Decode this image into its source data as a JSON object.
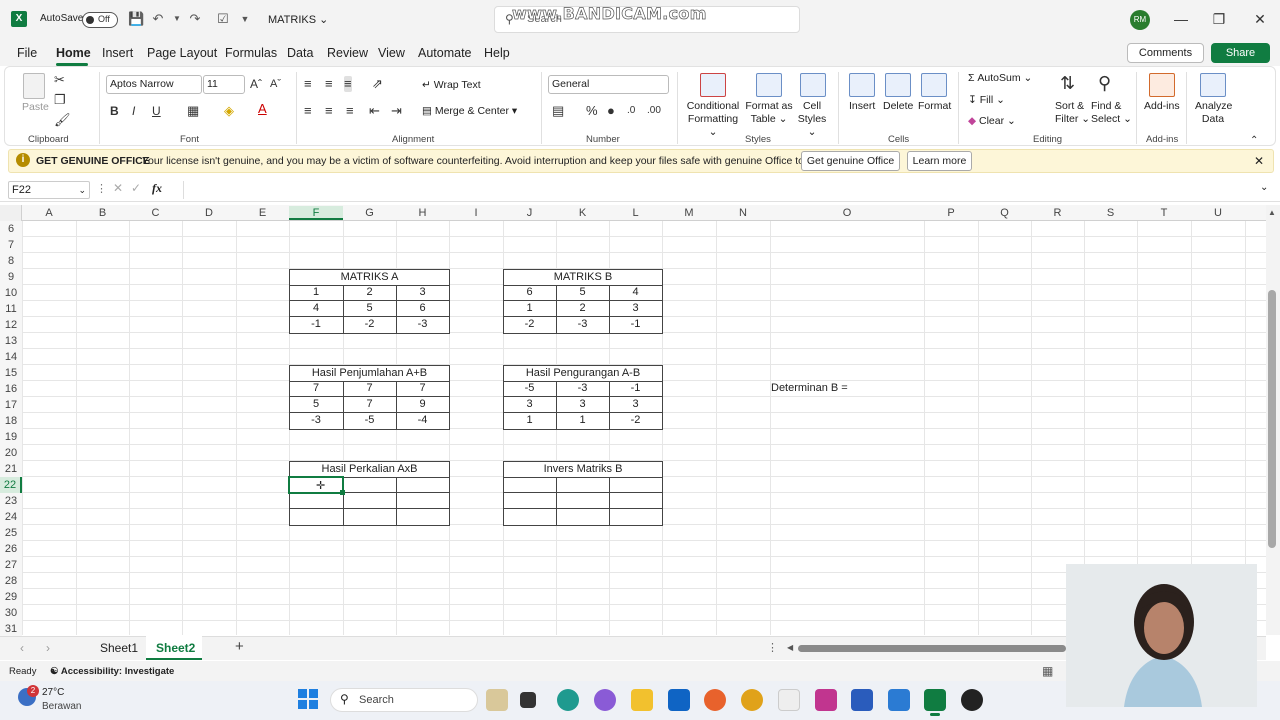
{
  "window": {
    "title": "MATRIKS",
    "autosave_label": "AutoSave",
    "autosave_state": "Off",
    "search_placeholder": "Search",
    "watermark": "www.BANDICAM.com",
    "user_initials": "RM",
    "accent": "#107c41"
  },
  "menu": {
    "items": [
      "File",
      "Home",
      "Insert",
      "Page Layout",
      "Formulas",
      "Data",
      "Review",
      "View",
      "Automate",
      "Help"
    ],
    "comments": "Comments",
    "share": "Share"
  },
  "ribbon": {
    "paste": "Paste",
    "clipboard": "Clipboard",
    "font_name": "Aptos Narrow",
    "font_size": "11",
    "font": "Font",
    "wrap_text": "Wrap Text",
    "merge_center": "Merge & Center",
    "alignment": "Alignment",
    "number_format": "General",
    "number": "Number",
    "cond_format_1": "Conditional",
    "cond_format_2": "Formatting",
    "format_table_1": "Format as",
    "format_table_2": "Table",
    "cell_styles_1": "Cell",
    "cell_styles_2": "Styles",
    "styles": "Styles",
    "insert": "Insert",
    "delete": "Delete",
    "format": "Format",
    "cells": "Cells",
    "autosum": "AutoSum",
    "fill": "Fill",
    "clear": "Clear",
    "sort_filter_1": "Sort &",
    "sort_filter_2": "Filter",
    "find_select_1": "Find &",
    "find_select_2": "Select",
    "editing": "Editing",
    "addins": "Add-ins",
    "addins_group": "Add-ins",
    "analyze_1": "Analyze",
    "analyze_2": "Data"
  },
  "infobar": {
    "title": "GET GENUINE OFFICE",
    "message": "Your license isn't genuine, and you may be a victim of software counterfeiting. Avoid interruption and keep your files safe with genuine Office today.",
    "get_button": "Get genuine Office",
    "learn_button": "Learn more"
  },
  "formula_bar": {
    "name_box": "F22",
    "fx": "fx"
  },
  "columns": [
    "A",
    "B",
    "C",
    "D",
    "E",
    "F",
    "G",
    "H",
    "I",
    "J",
    "K",
    "L",
    "M",
    "N",
    "O",
    "P",
    "Q",
    "R",
    "S",
    "T",
    "U"
  ],
  "rows": [
    "6",
    "7",
    "8",
    "9",
    "10",
    "11",
    "12",
    "13",
    "14",
    "15",
    "16",
    "17",
    "18",
    "19",
    "20",
    "21",
    "22",
    "23",
    "24",
    "25",
    "26",
    "27",
    "28",
    "29",
    "30",
    "31"
  ],
  "tables": {
    "matriks_a": {
      "title": "MATRIKS A",
      "cells": [
        [
          "1",
          "2",
          "3"
        ],
        [
          "4",
          "5",
          "6"
        ],
        [
          "-1",
          "-2",
          "-3"
        ]
      ]
    },
    "matriks_b": {
      "title": "MATRIKS B",
      "cells": [
        [
          "6",
          "5",
          "4"
        ],
        [
          "1",
          "2",
          "3"
        ],
        [
          "-2",
          "-3",
          "-1"
        ]
      ]
    },
    "penjumlahan": {
      "title": "Hasil Penjumlahan A+B",
      "cells": [
        [
          "7",
          "7",
          "7"
        ],
        [
          "5",
          "7",
          "9"
        ],
        [
          "-3",
          "-5",
          "-4"
        ]
      ]
    },
    "pengurangan": {
      "title": "Hasil Pengurangan A-B",
      "cells": [
        [
          "-5",
          "-3",
          "-1"
        ],
        [
          "3",
          "3",
          "3"
        ],
        [
          "1",
          "1",
          "-2"
        ]
      ]
    },
    "perkalian": {
      "title": "Hasil Perkalian AxB",
      "cells": [
        [
          "",
          "",
          ""
        ],
        [
          "",
          "",
          ""
        ],
        [
          "",
          "",
          ""
        ]
      ]
    },
    "invers": {
      "title": "Invers Matriks B",
      "cells": [
        [
          "",
          "",
          ""
        ],
        [
          "",
          "",
          ""
        ],
        [
          "",
          "",
          ""
        ]
      ]
    }
  },
  "determinan_label": "Determinan B  =",
  "sheets": {
    "tabs": [
      "Sheet1",
      "Sheet2"
    ],
    "active": "Sheet2"
  },
  "status": {
    "ready": "Ready",
    "accessibility": "Accessibility: Investigate"
  },
  "taskbar": {
    "temperature": "27°C",
    "weather": "Berawan",
    "badge": "2",
    "search": "Search"
  }
}
